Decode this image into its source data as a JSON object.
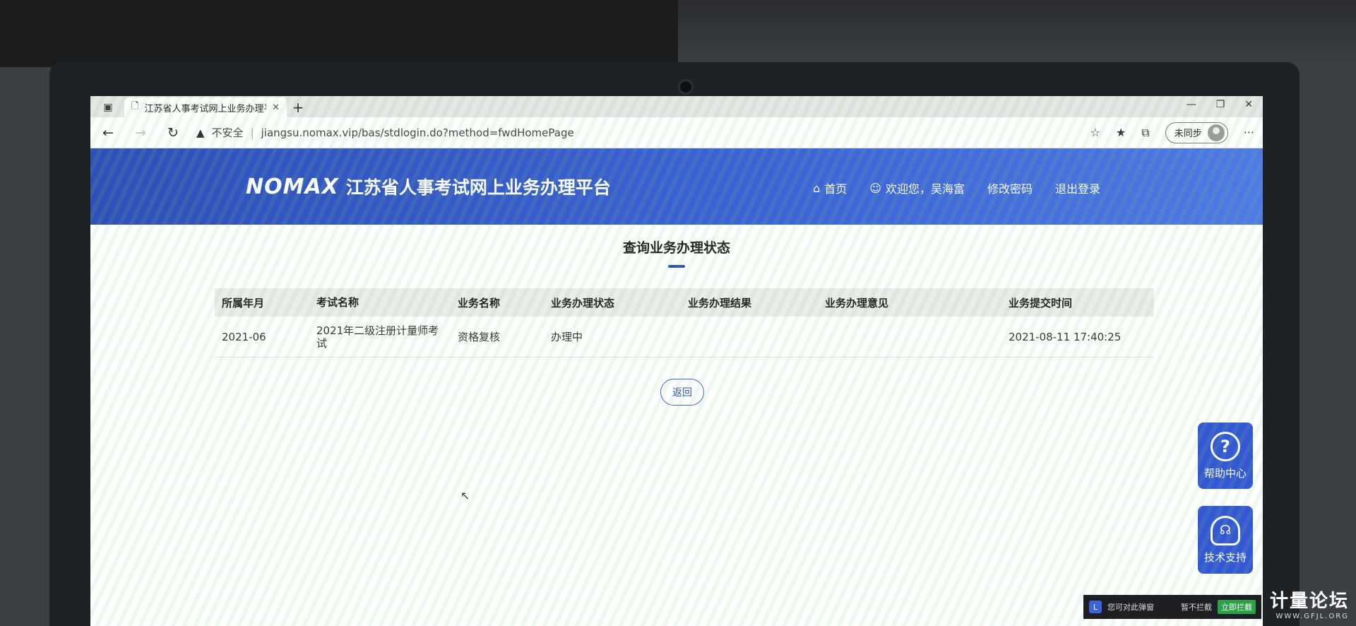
{
  "browser": {
    "tab_title": "江苏省人事考试网上业务办理平台",
    "url_warning": "不安全",
    "url": "jiangsu.nomax.vip/bas/stdlogin.do?method=fwdHomePage",
    "sync_label": "未同步"
  },
  "site": {
    "logo": "NOMAX",
    "title": "江苏省人事考试网上业务办理平台",
    "nav": {
      "home": "首页",
      "welcome": "欢迎您，吴海富",
      "change_password": "修改密码",
      "logout": "退出登录"
    }
  },
  "page": {
    "title": "查询业务办理状态",
    "back_label": "返回"
  },
  "table": {
    "headers": [
      "所属年月",
      "考试名称",
      "业务名称",
      "业务办理状态",
      "业务办理结果",
      "业务办理意见",
      "业务提交时间"
    ],
    "rows": [
      [
        "2021-06",
        "2021年二级注册计量师考试",
        "资格复核",
        "办理中",
        "",
        "",
        "2021-08-11 17:40:25"
      ]
    ]
  },
  "floating": {
    "help_label": "帮助中心",
    "tech_label": "技术支持"
  },
  "popup": {
    "text": "您可对此弹窗",
    "dismiss_label": "暂不拦截",
    "block_label": "立即拦截"
  },
  "watermark": {
    "main": "计量论坛",
    "sub": "WWW.GFJL.ORG"
  },
  "colors": {
    "header_blue": "#2f4fb9",
    "accent_blue": "#3458d4"
  }
}
